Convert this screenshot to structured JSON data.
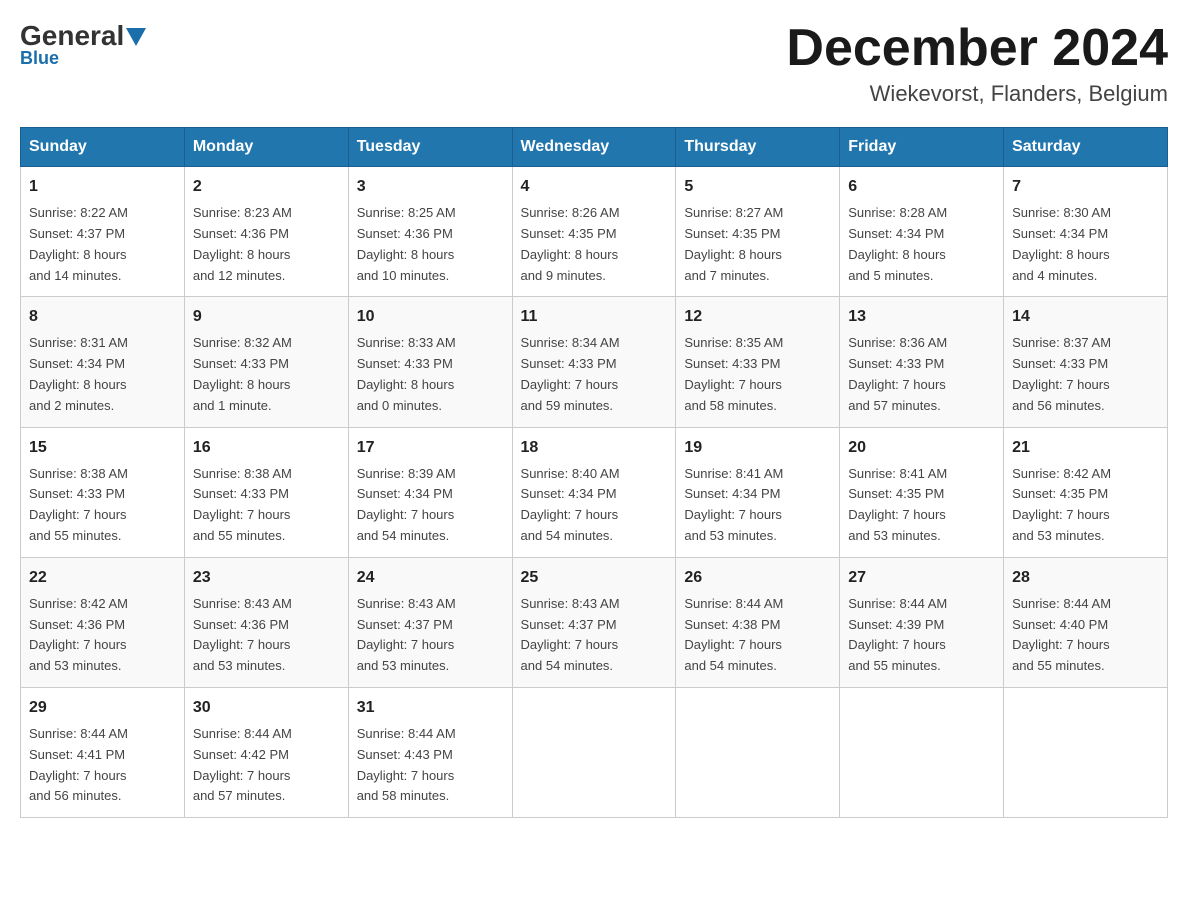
{
  "logo": {
    "general": "General",
    "blue": "Blue",
    "tagline": "Blue"
  },
  "title": "December 2024",
  "location": "Wiekevorst, Flanders, Belgium",
  "days_of_week": [
    "Sunday",
    "Monday",
    "Tuesday",
    "Wednesday",
    "Thursday",
    "Friday",
    "Saturday"
  ],
  "weeks": [
    [
      {
        "day": "1",
        "info": "Sunrise: 8:22 AM\nSunset: 4:37 PM\nDaylight: 8 hours\nand 14 minutes."
      },
      {
        "day": "2",
        "info": "Sunrise: 8:23 AM\nSunset: 4:36 PM\nDaylight: 8 hours\nand 12 minutes."
      },
      {
        "day": "3",
        "info": "Sunrise: 8:25 AM\nSunset: 4:36 PM\nDaylight: 8 hours\nand 10 minutes."
      },
      {
        "day": "4",
        "info": "Sunrise: 8:26 AM\nSunset: 4:35 PM\nDaylight: 8 hours\nand 9 minutes."
      },
      {
        "day": "5",
        "info": "Sunrise: 8:27 AM\nSunset: 4:35 PM\nDaylight: 8 hours\nand 7 minutes."
      },
      {
        "day": "6",
        "info": "Sunrise: 8:28 AM\nSunset: 4:34 PM\nDaylight: 8 hours\nand 5 minutes."
      },
      {
        "day": "7",
        "info": "Sunrise: 8:30 AM\nSunset: 4:34 PM\nDaylight: 8 hours\nand 4 minutes."
      }
    ],
    [
      {
        "day": "8",
        "info": "Sunrise: 8:31 AM\nSunset: 4:34 PM\nDaylight: 8 hours\nand 2 minutes."
      },
      {
        "day": "9",
        "info": "Sunrise: 8:32 AM\nSunset: 4:33 PM\nDaylight: 8 hours\nand 1 minute."
      },
      {
        "day": "10",
        "info": "Sunrise: 8:33 AM\nSunset: 4:33 PM\nDaylight: 8 hours\nand 0 minutes."
      },
      {
        "day": "11",
        "info": "Sunrise: 8:34 AM\nSunset: 4:33 PM\nDaylight: 7 hours\nand 59 minutes."
      },
      {
        "day": "12",
        "info": "Sunrise: 8:35 AM\nSunset: 4:33 PM\nDaylight: 7 hours\nand 58 minutes."
      },
      {
        "day": "13",
        "info": "Sunrise: 8:36 AM\nSunset: 4:33 PM\nDaylight: 7 hours\nand 57 minutes."
      },
      {
        "day": "14",
        "info": "Sunrise: 8:37 AM\nSunset: 4:33 PM\nDaylight: 7 hours\nand 56 minutes."
      }
    ],
    [
      {
        "day": "15",
        "info": "Sunrise: 8:38 AM\nSunset: 4:33 PM\nDaylight: 7 hours\nand 55 minutes."
      },
      {
        "day": "16",
        "info": "Sunrise: 8:38 AM\nSunset: 4:33 PM\nDaylight: 7 hours\nand 55 minutes."
      },
      {
        "day": "17",
        "info": "Sunrise: 8:39 AM\nSunset: 4:34 PM\nDaylight: 7 hours\nand 54 minutes."
      },
      {
        "day": "18",
        "info": "Sunrise: 8:40 AM\nSunset: 4:34 PM\nDaylight: 7 hours\nand 54 minutes."
      },
      {
        "day": "19",
        "info": "Sunrise: 8:41 AM\nSunset: 4:34 PM\nDaylight: 7 hours\nand 53 minutes."
      },
      {
        "day": "20",
        "info": "Sunrise: 8:41 AM\nSunset: 4:35 PM\nDaylight: 7 hours\nand 53 minutes."
      },
      {
        "day": "21",
        "info": "Sunrise: 8:42 AM\nSunset: 4:35 PM\nDaylight: 7 hours\nand 53 minutes."
      }
    ],
    [
      {
        "day": "22",
        "info": "Sunrise: 8:42 AM\nSunset: 4:36 PM\nDaylight: 7 hours\nand 53 minutes."
      },
      {
        "day": "23",
        "info": "Sunrise: 8:43 AM\nSunset: 4:36 PM\nDaylight: 7 hours\nand 53 minutes."
      },
      {
        "day": "24",
        "info": "Sunrise: 8:43 AM\nSunset: 4:37 PM\nDaylight: 7 hours\nand 53 minutes."
      },
      {
        "day": "25",
        "info": "Sunrise: 8:43 AM\nSunset: 4:37 PM\nDaylight: 7 hours\nand 54 minutes."
      },
      {
        "day": "26",
        "info": "Sunrise: 8:44 AM\nSunset: 4:38 PM\nDaylight: 7 hours\nand 54 minutes."
      },
      {
        "day": "27",
        "info": "Sunrise: 8:44 AM\nSunset: 4:39 PM\nDaylight: 7 hours\nand 55 minutes."
      },
      {
        "day": "28",
        "info": "Sunrise: 8:44 AM\nSunset: 4:40 PM\nDaylight: 7 hours\nand 55 minutes."
      }
    ],
    [
      {
        "day": "29",
        "info": "Sunrise: 8:44 AM\nSunset: 4:41 PM\nDaylight: 7 hours\nand 56 minutes."
      },
      {
        "day": "30",
        "info": "Sunrise: 8:44 AM\nSunset: 4:42 PM\nDaylight: 7 hours\nand 57 minutes."
      },
      {
        "day": "31",
        "info": "Sunrise: 8:44 AM\nSunset: 4:43 PM\nDaylight: 7 hours\nand 58 minutes."
      },
      {
        "day": "",
        "info": ""
      },
      {
        "day": "",
        "info": ""
      },
      {
        "day": "",
        "info": ""
      },
      {
        "day": "",
        "info": ""
      }
    ]
  ]
}
